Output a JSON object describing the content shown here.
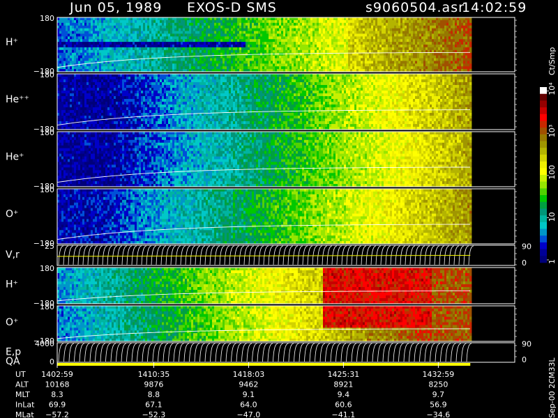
{
  "header": {
    "date": "Jun 05, 1989",
    "instrument": "EXOS-D SMS",
    "file": "s9060504.asr",
    "time": "14:02:59"
  },
  "footer_tag": "Sep-00 2CM33L",
  "colorbar": {
    "unit": "Ct/Smp",
    "labels": [
      {
        "text": "10⁴",
        "v": 10000
      },
      {
        "text": "10³",
        "v": 1000
      },
      {
        "text": "100",
        "v": 100
      },
      {
        "text": "10",
        "v": 10
      },
      {
        "text": "1",
        "v": 1
      }
    ],
    "colors": [
      "#00007a",
      "#000096",
      "#0000c8",
      "#0050d8",
      "#0096c8",
      "#00c8c8",
      "#00b4a0",
      "#009678",
      "#00a040",
      "#00c800",
      "#50d200",
      "#96e600",
      "#c8f000",
      "#ffff00",
      "#f0f000",
      "#d2d200",
      "#b4b400",
      "#a09600",
      "#967800",
      "#a05000",
      "#c82800",
      "#ff0000",
      "#c80000",
      "#960000",
      "#640000",
      "#ffffff"
    ]
  },
  "chart_data": {
    "type": "heatmap",
    "title": "Jun 05, 1989   EXOS-D SMS",
    "time_axis": {
      "start": "14:02:59",
      "end": "14:39:00",
      "data_end": "14:35:30",
      "tick_times": [
        "14:02:59",
        "14:10:35",
        "14:18:03",
        "14:25:31",
        "14:32:59"
      ]
    },
    "panels": [
      {
        "label": "H⁺",
        "y_top": "180",
        "y_bottom": "−180",
        "ylim": [
          -180,
          180
        ],
        "profile": "h"
      },
      {
        "label": "He⁺⁺",
        "y_top": "180",
        "y_bottom": "−180",
        "ylim": [
          -180,
          180
        ],
        "profile": "hepp"
      },
      {
        "label": "He⁺",
        "y_top": "180",
        "y_bottom": "−180",
        "ylim": [
          -180,
          180
        ],
        "profile": "hep"
      },
      {
        "label": "O⁺",
        "y_top": "180",
        "y_bottom": "−180",
        "ylim": [
          -180,
          180
        ],
        "profile": "op"
      },
      {
        "label": "V,r",
        "y_top": "25",
        "y_bottom": "",
        "right_top": "90",
        "right_bottom": "0",
        "profile": "vr"
      },
      {
        "label": "H⁺",
        "y_top": "180",
        "y_bottom": "−180",
        "ylim": [
          -180,
          180
        ],
        "profile": "h2"
      },
      {
        "label": "O⁺",
        "y_top": "180",
        "y_bottom": "−180",
        "ylim": [
          -180,
          180
        ],
        "profile": "o2"
      },
      {
        "label": "E,p",
        "label2": "QA",
        "y_top": "4000",
        "y_bottom": "0",
        "right_top": "90",
        "right_bottom": "0",
        "profile": "ep"
      }
    ],
    "ephemeris": {
      "rows": [
        {
          "name": "UT",
          "values": [
            "1402:59",
            "1410:35",
            "1418:03",
            "1425:31",
            "1432:59"
          ]
        },
        {
          "name": "ALT",
          "values": [
            "10168",
            "9876",
            "9462",
            "8921",
            "8250"
          ]
        },
        {
          "name": "MLT",
          "values": [
            "8.3",
            "8.8",
            "9.1",
            "9.4",
            "9.7"
          ]
        },
        {
          "name": "InLat",
          "values": [
            "69.9",
            "67.1",
            "64.0",
            "60.6",
            "56.9"
          ]
        },
        {
          "name": "MLat",
          "values": [
            "−57.2",
            "−52.3",
            "−47.0",
            "−41.1",
            "−34.6"
          ]
        }
      ]
    }
  }
}
